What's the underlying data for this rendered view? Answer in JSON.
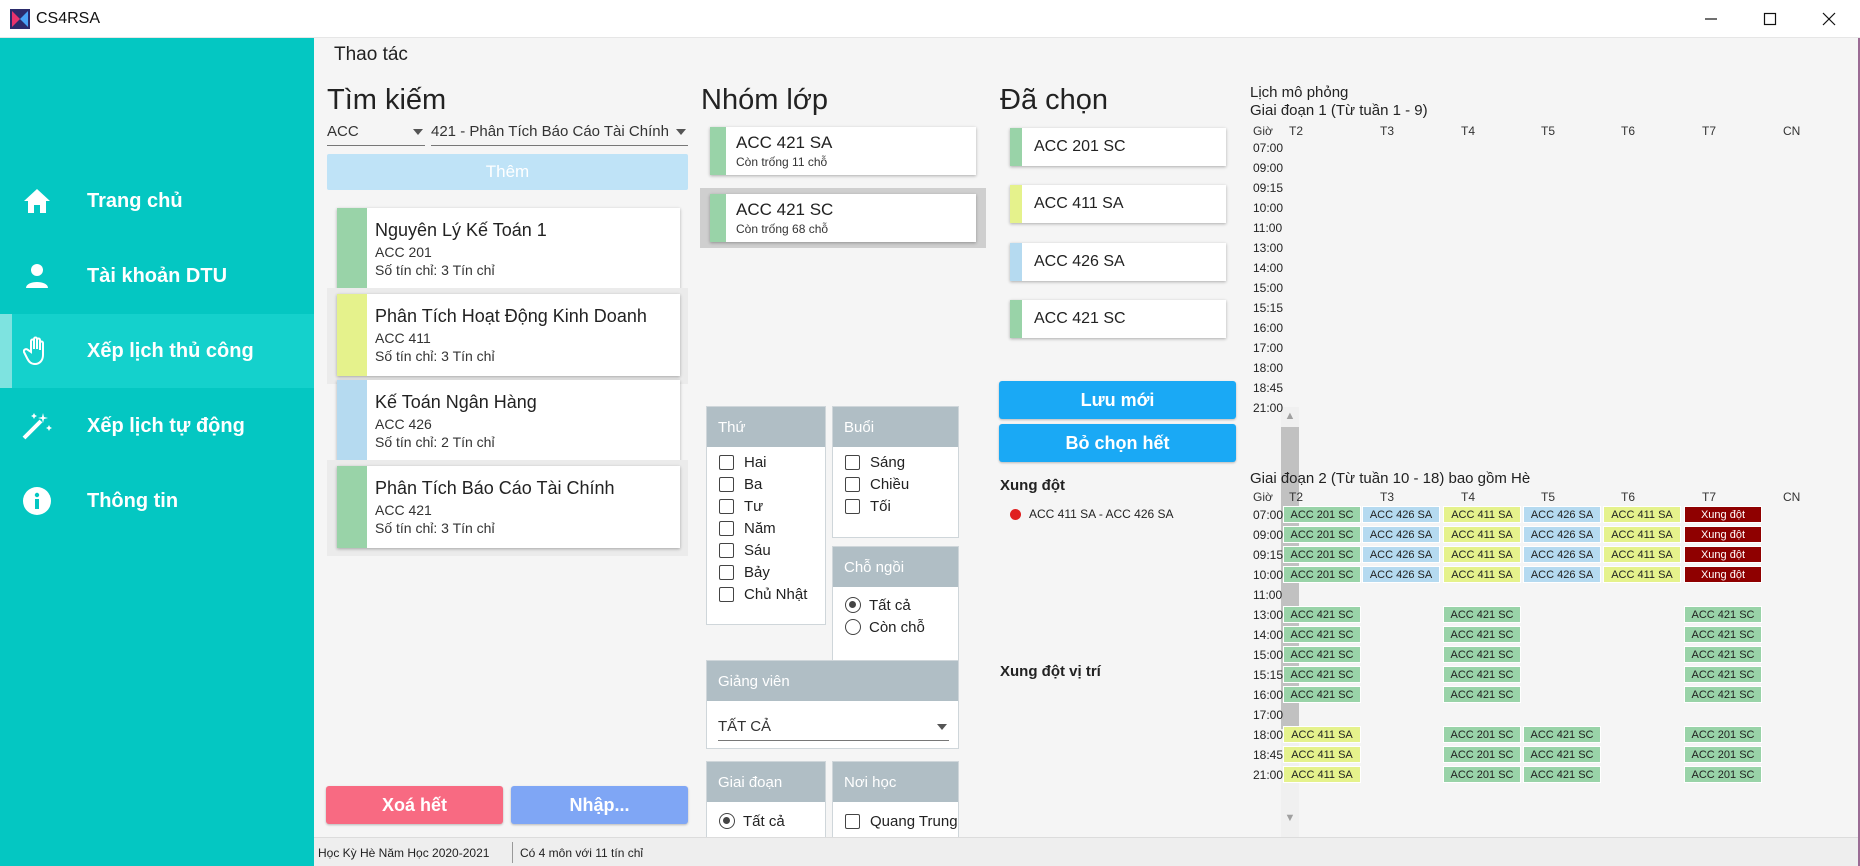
{
  "window": {
    "title": "CS4RSA"
  },
  "sidebar": {
    "items": [
      {
        "label": "Trang chủ",
        "icon": "home-icon"
      },
      {
        "label": "Tài khoản DTU",
        "icon": "account-icon"
      },
      {
        "label": "Xếp lịch thủ công",
        "icon": "hand-icon",
        "active": true
      },
      {
        "label": "Xếp lịch tự động",
        "icon": "magic-wand-icon"
      },
      {
        "label": "Thông tin",
        "icon": "info-icon"
      }
    ]
  },
  "header": {
    "title": "Thao tác"
  },
  "search": {
    "title": "Tìm kiếm",
    "discipline": "ACC",
    "keyword": "421  -  Phân Tích Báo Cáo Tài Chính",
    "add_button": "Thêm",
    "subjects": [
      {
        "name": "Nguyên Lý Kế Toán 1",
        "code": "ACC 201",
        "credits": "Số tín chỉ: 3 Tín chỉ",
        "color": "#99d3a8"
      },
      {
        "name": "Phân Tích Hoạt Động Kinh Doanh",
        "code": "ACC 411",
        "credits": "Số tín chỉ: 3 Tín chỉ",
        "color": "#e5f28c"
      },
      {
        "name": "Kế Toán Ngân Hàng",
        "code": "ACC 426",
        "credits": "Số tín chỉ: 2 Tín chỉ",
        "color": "#b5daf0"
      },
      {
        "name": "Phân Tích Báo Cáo Tài Chính",
        "code": "ACC 421",
        "credits": "Số tín chỉ: 3 Tín chỉ",
        "color": "#99d3a8"
      }
    ],
    "clear_button": "Xoá hết",
    "import_button": "Nhập..."
  },
  "class_groups": {
    "title": "Nhóm lớp",
    "items": [
      {
        "code": "ACC 421 SA",
        "seats": "Còn trống 11 chỗ"
      },
      {
        "code": "ACC 421 SC",
        "seats": "Còn trống 68 chỗ"
      }
    ]
  },
  "filters": {
    "day": {
      "title": "Thứ",
      "options": [
        "Hai",
        "Ba",
        "Tư",
        "Năm",
        "Sáu",
        "Bảy",
        "Chủ Nhật"
      ]
    },
    "session": {
      "title": "Buổi",
      "options": [
        "Sáng",
        "Chiều",
        "Tối"
      ]
    },
    "seat": {
      "title": "Chỗ ngồi",
      "options": [
        "Tất cả",
        "Còn chỗ"
      ],
      "selected": "Tất cả"
    },
    "lecturer": {
      "title": "Giảng viên",
      "value": "TẤT CẢ"
    },
    "phase": {
      "title": "Giai đoạn",
      "options": [
        "Tất cả"
      ],
      "selected": "Tất cả"
    },
    "place": {
      "title": "Nơi học",
      "options": [
        "Quang Trung"
      ]
    }
  },
  "chosen": {
    "title": "Đã chọn",
    "items": [
      {
        "code": "ACC 201 SC",
        "color": "#99d3a8"
      },
      {
        "code": "ACC 411 SA",
        "color": "#e5f28c"
      },
      {
        "code": "ACC 426 SA",
        "color": "#b5daf0"
      },
      {
        "code": "ACC 421 SC",
        "color": "#99d3a8"
      }
    ],
    "save_button": "Lưu mới",
    "clear_button": "Bỏ chọn hết",
    "conflict_title": "Xung đột",
    "conflicts": [
      "ACC 411 SA  -  ACC 426 SA"
    ],
    "place_conflict_title": "Xung đột vị trí"
  },
  "schedule": {
    "title": "Lịch mô phỏng",
    "hour_label": "Giờ",
    "days": [
      "T2",
      "T3",
      "T4",
      "T5",
      "T6",
      "T7",
      "CN"
    ],
    "phase1": {
      "title": "Giai đoạn 1 (Từ tuần 1 - 9)",
      "times": [
        "07:00",
        "09:00",
        "09:15",
        "10:00",
        "11:00",
        "13:00",
        "14:00",
        "15:00",
        "15:15",
        "16:00",
        "17:00",
        "18:00",
        "18:45",
        "21:00"
      ]
    },
    "phase2": {
      "title": "Giai đoạn 2 (Từ tuần 10 - 18) bao gồm Hè",
      "times": [
        "07:00",
        "09:00",
        "09:15",
        "10:00",
        "11:00",
        "13:00",
        "14:00",
        "15:00",
        "15:15",
        "16:00",
        "17:00",
        "18:00",
        "18:45",
        "21:00"
      ],
      "cells": [
        {
          "row": 0,
          "col": 0,
          "text": "ACC 201 SC",
          "color": "green"
        },
        {
          "row": 0,
          "col": 1,
          "text": "ACC 426 SA",
          "color": "blue"
        },
        {
          "row": 0,
          "col": 2,
          "text": "ACC 411 SA",
          "color": "yellow"
        },
        {
          "row": 0,
          "col": 3,
          "text": "ACC 426 SA",
          "color": "blue"
        },
        {
          "row": 0,
          "col": 4,
          "text": "ACC 411 SA",
          "color": "yellow"
        },
        {
          "row": 0,
          "col": 5,
          "text": "Xung đột",
          "color": "red"
        },
        {
          "row": 1,
          "col": 0,
          "text": "ACC 201 SC",
          "color": "green"
        },
        {
          "row": 1,
          "col": 1,
          "text": "ACC 426 SA",
          "color": "blue"
        },
        {
          "row": 1,
          "col": 2,
          "text": "ACC 411 SA",
          "color": "yellow"
        },
        {
          "row": 1,
          "col": 3,
          "text": "ACC 426 SA",
          "color": "blue"
        },
        {
          "row": 1,
          "col": 4,
          "text": "ACC 411 SA",
          "color": "yellow"
        },
        {
          "row": 1,
          "col": 5,
          "text": "Xung đột",
          "color": "red"
        },
        {
          "row": 2,
          "col": 0,
          "text": "ACC 201 SC",
          "color": "green"
        },
        {
          "row": 2,
          "col": 1,
          "text": "ACC 426 SA",
          "color": "blue"
        },
        {
          "row": 2,
          "col": 2,
          "text": "ACC 411 SA",
          "color": "yellow"
        },
        {
          "row": 2,
          "col": 3,
          "text": "ACC 426 SA",
          "color": "blue"
        },
        {
          "row": 2,
          "col": 4,
          "text": "ACC 411 SA",
          "color": "yellow"
        },
        {
          "row": 2,
          "col": 5,
          "text": "Xung đột",
          "color": "red"
        },
        {
          "row": 3,
          "col": 0,
          "text": "ACC 201 SC",
          "color": "green"
        },
        {
          "row": 3,
          "col": 1,
          "text": "ACC 426 SA",
          "color": "blue"
        },
        {
          "row": 3,
          "col": 2,
          "text": "ACC 411 SA",
          "color": "yellow"
        },
        {
          "row": 3,
          "col": 3,
          "text": "ACC 426 SA",
          "color": "blue"
        },
        {
          "row": 3,
          "col": 4,
          "text": "ACC 411 SA",
          "color": "yellow"
        },
        {
          "row": 3,
          "col": 5,
          "text": "Xung đột",
          "color": "red"
        },
        {
          "row": 5,
          "col": 0,
          "text": "ACC 421 SC",
          "color": "green"
        },
        {
          "row": 5,
          "col": 2,
          "text": "ACC 421 SC",
          "color": "green"
        },
        {
          "row": 5,
          "col": 5,
          "text": "ACC 421 SC",
          "color": "green"
        },
        {
          "row": 6,
          "col": 0,
          "text": "ACC 421 SC",
          "color": "green"
        },
        {
          "row": 6,
          "col": 2,
          "text": "ACC 421 SC",
          "color": "green"
        },
        {
          "row": 6,
          "col": 5,
          "text": "ACC 421 SC",
          "color": "green"
        },
        {
          "row": 7,
          "col": 0,
          "text": "ACC 421 SC",
          "color": "green"
        },
        {
          "row": 7,
          "col": 2,
          "text": "ACC 421 SC",
          "color": "green"
        },
        {
          "row": 7,
          "col": 5,
          "text": "ACC 421 SC",
          "color": "green"
        },
        {
          "row": 8,
          "col": 0,
          "text": "ACC 421 SC",
          "color": "green"
        },
        {
          "row": 8,
          "col": 2,
          "text": "ACC 421 SC",
          "color": "green"
        },
        {
          "row": 8,
          "col": 5,
          "text": "ACC 421 SC",
          "color": "green"
        },
        {
          "row": 9,
          "col": 0,
          "text": "ACC 421 SC",
          "color": "green"
        },
        {
          "row": 9,
          "col": 2,
          "text": "ACC 421 SC",
          "color": "green"
        },
        {
          "row": 9,
          "col": 5,
          "text": "ACC 421 SC",
          "color": "green"
        },
        {
          "row": 11,
          "col": 0,
          "text": "ACC 411 SA",
          "color": "yellow"
        },
        {
          "row": 11,
          "col": 2,
          "text": "ACC 201 SC",
          "color": "green"
        },
        {
          "row": 11,
          "col": 3,
          "text": "ACC 421 SC",
          "color": "green"
        },
        {
          "row": 11,
          "col": 5,
          "text": "ACC 201 SC",
          "color": "green"
        },
        {
          "row": 12,
          "col": 0,
          "text": "ACC 411 SA",
          "color": "yellow"
        },
        {
          "row": 12,
          "col": 2,
          "text": "ACC 201 SC",
          "color": "green"
        },
        {
          "row": 12,
          "col": 3,
          "text": "ACC 421 SC",
          "color": "green"
        },
        {
          "row": 12,
          "col": 5,
          "text": "ACC 201 SC",
          "color": "green"
        },
        {
          "row": 13,
          "col": 0,
          "text": "ACC 411 SA",
          "color": "yellow"
        },
        {
          "row": 13,
          "col": 2,
          "text": "ACC 201 SC",
          "color": "green"
        },
        {
          "row": 13,
          "col": 3,
          "text": "ACC 421 SC",
          "color": "green"
        },
        {
          "row": 13,
          "col": 5,
          "text": "ACC 201 SC",
          "color": "green"
        }
      ]
    }
  },
  "status": {
    "semester": "Học Kỳ Hè Năm Học 2020-2021",
    "summary": "Có 4 môn với 11 tín chỉ"
  },
  "colors": {
    "sidebar": "#04c7c2",
    "accent_blue": "#1aa9f5",
    "clear_red": "#f86a82",
    "import_blue": "#7fa6f5",
    "conflict_red": "#8f0000"
  }
}
